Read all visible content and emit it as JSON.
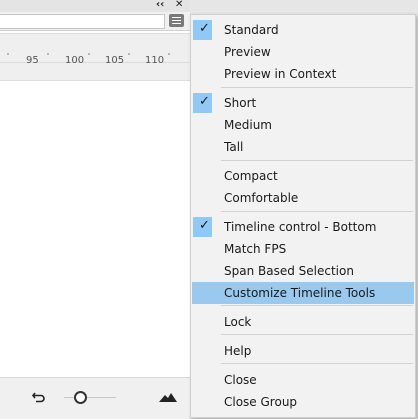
{
  "panel": {
    "controls": {
      "collapse_icon": "double-chevron-left",
      "close_icon": "close-x"
    },
    "ruler_labels": [
      "95",
      "100",
      "105",
      "110"
    ],
    "footer_icons": [
      "undo-icon",
      "zoom-slider",
      "mountain-icon"
    ]
  },
  "menu": {
    "accent_color": "#99c9ef",
    "items": [
      {
        "label": "Standard",
        "checked": true
      },
      {
        "label": "Preview",
        "checked": false
      },
      {
        "label": "Preview in Context",
        "checked": false
      },
      {
        "label": "Short",
        "checked": true
      },
      {
        "label": "Medium",
        "checked": false
      },
      {
        "label": "Tall",
        "checked": false
      },
      {
        "label": "Compact",
        "checked": false
      },
      {
        "label": "Comfortable",
        "checked": false
      },
      {
        "label": "Timeline control - Bottom",
        "checked": true
      },
      {
        "label": "Match FPS",
        "checked": false
      },
      {
        "label": "Span Based Selection",
        "checked": false
      },
      {
        "label": "Customize Timeline Tools",
        "checked": false,
        "highlighted": true
      },
      {
        "label": "Lock",
        "checked": false
      },
      {
        "label": "Help",
        "checked": false
      },
      {
        "label": "Close",
        "checked": false
      },
      {
        "label": "Close Group",
        "checked": false
      }
    ]
  }
}
